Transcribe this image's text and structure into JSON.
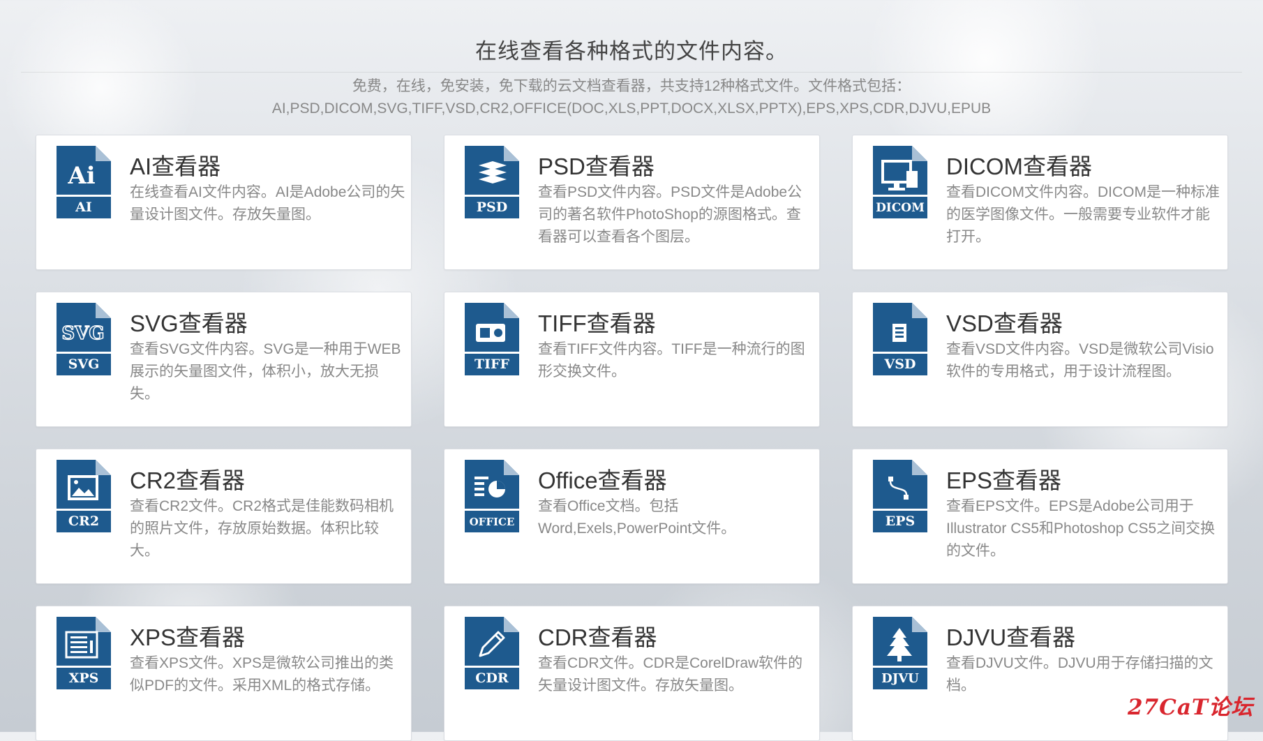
{
  "header": {
    "title": "在线查看各种格式的文件内容。",
    "subtitle_line1": "免费，在线，免安装，免下载的云文档查看器，共支持12种格式文件。文件格式包括：",
    "subtitle_line2": "AI,PSD,DICOM,SVG,TIFF,VSD,CR2,OFFICE(DOC,XLS,PPT,DOCX,XLSX,PPTX),EPS,XPS,CDR,DJVU,EPUB"
  },
  "colors": {
    "icon_blue": "#1e5a8e",
    "icon_fold": "#a9c0d6",
    "title": "#333333",
    "desc": "#888888",
    "watermark": "#d9262e"
  },
  "cards": [
    {
      "title": "AI查看器",
      "description": "在线查看AI文件内容。AI是Adobe公司的矢量设计图文件。存放矢量图。",
      "icon": "ai-file-icon",
      "badge": "AI"
    },
    {
      "title": "PSD查看器",
      "description": "查看PSD文件内容。PSD文件是Adobe公司的著名软件PhotoShop的源图格式。查看器可以查看各个图层。",
      "icon": "psd-file-icon",
      "badge": "PSD"
    },
    {
      "title": "DICOM查看器",
      "description": "查看DICOM文件内容。DICOM是一种标准的医学图像文件。一般需要专业软件才能打开。",
      "icon": "dicom-file-icon",
      "badge": "DICOM"
    },
    {
      "title": "SVG查看器",
      "description": "查看SVG文件内容。SVG是一种用于WEB展示的矢量图文件，体积小，放大无损失。",
      "icon": "svg-file-icon",
      "badge": "SVG"
    },
    {
      "title": "TIFF查看器",
      "description": "查看TIFF文件内容。TIFF是一种流行的图形交换文件。",
      "icon": "tiff-file-icon",
      "badge": "TIFF"
    },
    {
      "title": "VSD查看器",
      "description": "查看VSD文件内容。VSD是微软公司Visio软件的专用格式，用于设计流程图。",
      "icon": "vsd-file-icon",
      "badge": "VSD"
    },
    {
      "title": "CR2查看器",
      "description": "查看CR2文件。CR2格式是佳能数码相机的照片文件，存放原始数据。体积比较大。",
      "icon": "cr2-file-icon",
      "badge": "CR2"
    },
    {
      "title": "Office查看器",
      "description": "查看Office文档。包括Word,Exels,PowerPoint文件。",
      "icon": "office-file-icon",
      "badge": "OFFICE"
    },
    {
      "title": "EPS查看器",
      "description": "查看EPS文件。EPS是Adobe公司用于Illustrator CS5和Photoshop CS5之间交换的文件。",
      "icon": "eps-file-icon",
      "badge": "EPS"
    },
    {
      "title": "XPS查看器",
      "description": "查看XPS文件。XPS是微软公司推出的类似PDF的文件。采用XML的格式存储。",
      "icon": "xps-file-icon",
      "badge": "XPS"
    },
    {
      "title": "CDR查看器",
      "description": "查看CDR文件。CDR是CorelDraw软件的矢量设计图文件。存放矢量图。",
      "icon": "cdr-file-icon",
      "badge": "CDR"
    },
    {
      "title": "DJVU查看器",
      "description": "查看DJVU文件。DJVU用于存储扫描的文档。",
      "icon": "djvu-file-icon",
      "badge": "DJVU"
    }
  ],
  "watermark": "27CaT论坛"
}
